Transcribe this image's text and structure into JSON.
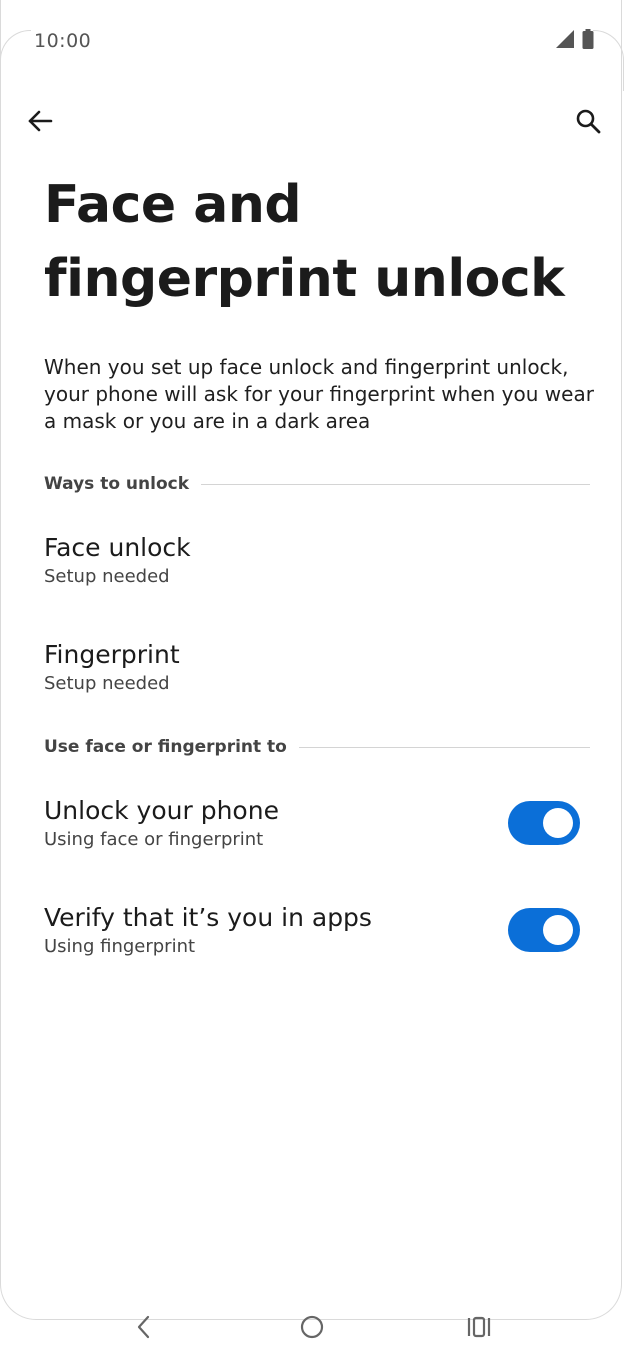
{
  "status_bar": {
    "time": "10:00",
    "icons": [
      "signal-icon",
      "battery-icon"
    ]
  },
  "app_bar": {
    "back_icon": "arrow-back-icon",
    "search_icon": "search-icon"
  },
  "page": {
    "title": "Face and fingerprint unlock",
    "description": "When you set up face unlock and fingerprint unlock, your phone will ask for your fingerprint when you wear a mask or you are in a dark area"
  },
  "sections": {
    "ways_to_unlock": {
      "header": "Ways to unlock",
      "items": [
        {
          "title": "Face unlock",
          "summary": "Setup needed"
        },
        {
          "title": "Fingerprint",
          "summary": "Setup needed"
        }
      ]
    },
    "use_for": {
      "header": "Use face or fingerprint to",
      "items": [
        {
          "title": "Unlock your phone",
          "summary": "Using face or fingerprint",
          "enabled": true
        },
        {
          "title": "Verify that it’s you in apps",
          "summary": "Using fingerprint",
          "enabled": true
        }
      ]
    }
  },
  "nav_bar": {
    "back": "nav-back-icon",
    "home": "nav-home-icon",
    "recents": "nav-recents-icon"
  },
  "colors": {
    "accent": "#0b6fd8",
    "text_primary": "#1b1b1b",
    "text_secondary": "#444444"
  }
}
